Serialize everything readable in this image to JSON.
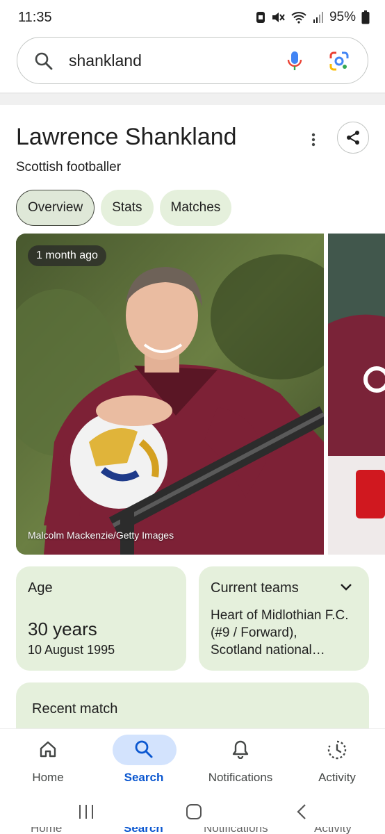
{
  "status_bar": {
    "time": "11:35",
    "battery": "95%"
  },
  "search": {
    "query": "shankland"
  },
  "entity": {
    "name": "Lawrence Shankland",
    "description": "Scottish footballer"
  },
  "tabs": [
    {
      "label": "Overview",
      "active": true
    },
    {
      "label": "Stats",
      "active": false
    },
    {
      "label": "Matches",
      "active": false
    }
  ],
  "media": {
    "time_badge": "1 month ago",
    "credit": "Malcolm Mackenzie/Getty Images"
  },
  "age_card": {
    "label": "Age",
    "value": "30 years",
    "date": "10 August 1995"
  },
  "teams_card": {
    "label": "Current teams",
    "text": "Heart of Midlothian F.C. (#9 / Forward), Scotland national…"
  },
  "recent_card": {
    "label": "Recent match"
  },
  "bottom_nav": [
    {
      "label": "Home",
      "icon": "home-icon"
    },
    {
      "label": "Search",
      "icon": "search-icon",
      "active": true
    },
    {
      "label": "Notifications",
      "icon": "bell-icon"
    },
    {
      "label": "Activity",
      "icon": "activity-icon"
    }
  ],
  "colors": {
    "accent": "#0b57d0",
    "card_bg": "#e5f0dc",
    "nav_pill": "#d3e3fd"
  }
}
